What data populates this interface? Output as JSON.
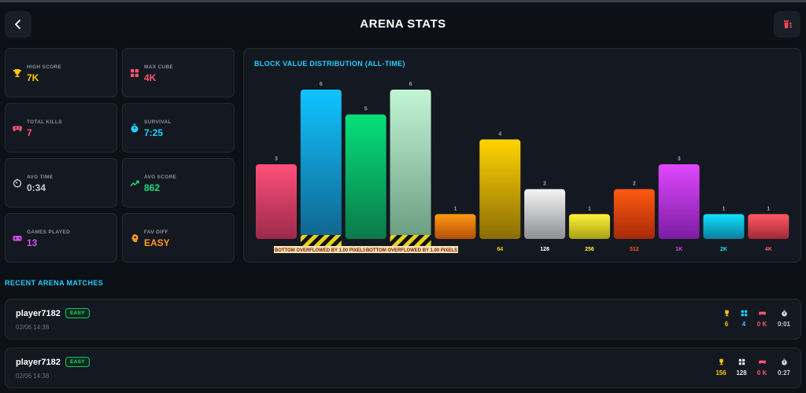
{
  "header": {
    "title": "ARENA STATS"
  },
  "stats": [
    {
      "label": "HIGH SCORE",
      "value": "7K",
      "icon": "trophy-icon",
      "color": "#ffc800"
    },
    {
      "label": "MAX CUBE",
      "value": "4K",
      "icon": "grid-icon",
      "color": "#ff5470"
    },
    {
      "label": "TOTAL KILLS",
      "value": "7",
      "icon": "gamepad-icon",
      "color": "#ff5470"
    },
    {
      "label": "SURVIVAL",
      "value": "7:25",
      "icon": "stopwatch-icon",
      "color": "#1fd0ff"
    },
    {
      "label": "AVG TIME",
      "value": "0:34",
      "icon": "timer-icon",
      "color": "#c8ccd4"
    },
    {
      "label": "AVG SCORE",
      "value": "862",
      "icon": "trending-up-icon",
      "color": "#1fe07c"
    },
    {
      "label": "GAMES PLAYED",
      "value": "13",
      "icon": "controller-icon",
      "color": "#d94cf0"
    },
    {
      "label": "FAV DIFF",
      "value": "EASY",
      "icon": "brain-icon",
      "color": "#ff9a1f"
    }
  ],
  "chart_data": {
    "type": "bar",
    "title": "BLOCK VALUE DISTRIBUTION (ALL-TIME)",
    "categories": [
      "",
      "",
      "",
      "",
      "",
      "64",
      "128",
      "256",
      "512",
      "1K",
      "2K",
      "4K"
    ],
    "values": [
      3,
      6,
      5,
      6,
      1,
      4,
      2,
      1,
      2,
      3,
      1,
      1
    ],
    "ylim": [
      0,
      6
    ],
    "bar_colors": [
      [
        "#ff4f7a",
        "#9c2a4a"
      ],
      [
        "#0fc4ff",
        "#11658f"
      ],
      [
        "#06e07a",
        "#0b7a4a"
      ],
      [
        "#c2f5d6",
        "#6a9c80"
      ],
      [
        "#ff9a12",
        "#b44e08"
      ],
      [
        "#ffd400",
        "#8c6d06"
      ],
      [
        "#f4f4f4",
        "#8e8f94"
      ],
      [
        "#fff23a",
        "#a8a012"
      ],
      [
        "#ff5a12",
        "#a62a08"
      ],
      [
        "#e047ff",
        "#7c1da3"
      ],
      [
        "#10e0ff",
        "#0b7f9e"
      ],
      [
        "#ff5a62",
        "#a3283a"
      ]
    ],
    "label_colors": [
      "#ff5470",
      "#1fd0ff",
      "#1fe07c",
      "#ffffff",
      "#ff9a1f",
      "#ffd400",
      "#ffffff",
      "#fff23a",
      "#ff5a12",
      "#e047ff",
      "#10e0ff",
      "#ff5a62"
    ],
    "overflow_label": "BOTTOM OVERFLOWED BY 1.00 PIXELS",
    "overflow_bars": [
      1,
      3
    ]
  },
  "recent": {
    "title": "RECENT ARENA MATCHES",
    "matches": [
      {
        "player": "player7182",
        "difficulty": "EASY",
        "date": "02/06 14:38",
        "stats": [
          {
            "icon": "trophy-icon",
            "value": "6",
            "color": "#ffc800"
          },
          {
            "icon": "grid-icon",
            "value": "4",
            "color": "#1fd0ff"
          },
          {
            "icon": "gamepad-icon",
            "value": "0 K",
            "color": "#ff5470"
          },
          {
            "icon": "stopwatch-icon",
            "value": "0:01",
            "color": "#c8ccd4"
          }
        ]
      },
      {
        "player": "player7182",
        "difficulty": "EASY",
        "date": "02/06 14:38",
        "stats": [
          {
            "icon": "trophy-icon",
            "value": "156",
            "color": "#ffc800"
          },
          {
            "icon": "grid-icon",
            "value": "128",
            "color": "#e6e6e6"
          },
          {
            "icon": "gamepad-icon",
            "value": "0 K",
            "color": "#ff5470"
          },
          {
            "icon": "stopwatch-icon",
            "value": "0:27",
            "color": "#c8ccd4"
          }
        ]
      }
    ]
  }
}
